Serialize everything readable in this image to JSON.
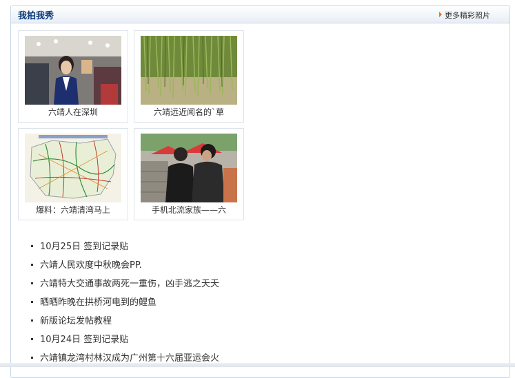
{
  "section": {
    "title": "我拍我秀",
    "more_label": "更多精彩照片"
  },
  "photos": [
    {
      "caption": "六靖人在深圳",
      "icon": "photo-store-girl"
    },
    {
      "caption": "六靖远近闻名的`草",
      "icon": "photo-grass"
    },
    {
      "caption": "爆料：六靖清湾马上",
      "icon": "photo-map"
    },
    {
      "caption": "手机北流家族——六",
      "icon": "photo-two-men"
    }
  ],
  "news": [
    "10月25日 签到记录贴",
    "六靖人民欢度中秋晚会PP.",
    "六靖特大交通事故两死一重伤，凶手逃之夭夭",
    "晒晒昨晚在拱桥河电到的鲤鱼",
    "新版论坛发帖教程",
    "10月24日 签到记录贴",
    "六靖镇龙湾村林汉成为广州第十六届亚运会火"
  ],
  "colors": {
    "title": "#0b3a7a",
    "border": "#c9d6e6",
    "arrow": "#e8731b"
  }
}
